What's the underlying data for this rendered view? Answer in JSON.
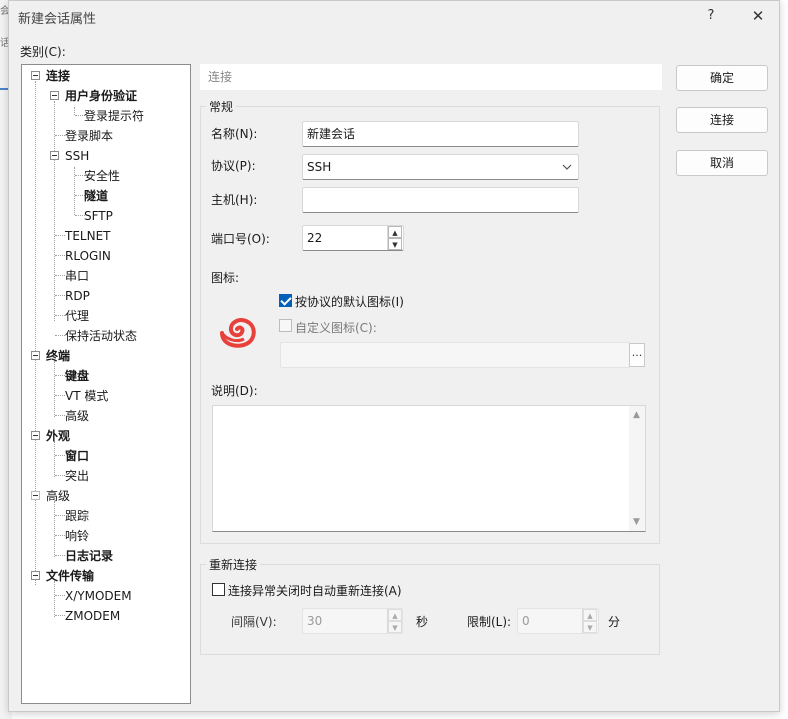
{
  "window": {
    "title": "新建会话属性",
    "help_glyph": "?",
    "close_glyph": "✕"
  },
  "background": {
    "marks": [
      "会",
      "话"
    ]
  },
  "category": {
    "label": "类别(C):",
    "tree": [
      {
        "label": "连接",
        "bold": true,
        "expanded": true
      },
      {
        "label": "用户身份验证",
        "bold": true,
        "expanded": true
      },
      {
        "label": "登录提示符",
        "bold": false
      },
      {
        "label": "登录脚本",
        "bold": false
      },
      {
        "label": "SSH",
        "bold": false,
        "expanded": true
      },
      {
        "label": "安全性",
        "bold": false
      },
      {
        "label": "隧道",
        "bold": true
      },
      {
        "label": "SFTP",
        "bold": false
      },
      {
        "label": "TELNET",
        "bold": false
      },
      {
        "label": "RLOGIN",
        "bold": false
      },
      {
        "label": "串口",
        "bold": false
      },
      {
        "label": "RDP",
        "bold": false
      },
      {
        "label": "代理",
        "bold": false
      },
      {
        "label": "保持活动状态",
        "bold": false
      },
      {
        "label": "终端",
        "bold": true,
        "expanded": true
      },
      {
        "label": "键盘",
        "bold": true
      },
      {
        "label": "VT 模式",
        "bold": false
      },
      {
        "label": "高级",
        "bold": false
      },
      {
        "label": "外观",
        "bold": true,
        "expanded": true
      },
      {
        "label": "窗口",
        "bold": true
      },
      {
        "label": "突出",
        "bold": false
      },
      {
        "label": "高级",
        "bold": false,
        "expanded": true
      },
      {
        "label": "跟踪",
        "bold": false
      },
      {
        "label": "响铃",
        "bold": false
      },
      {
        "label": "日志记录",
        "bold": true
      },
      {
        "label": "文件传输",
        "bold": true,
        "expanded": true
      },
      {
        "label": "X/YMODEM",
        "bold": false
      },
      {
        "label": "ZMODEM",
        "bold": false
      }
    ]
  },
  "section_title": "连接",
  "general": {
    "group_title": "常规",
    "name_label": "名称(N):",
    "name_value": "新建会话",
    "protocol_label": "协议(P):",
    "protocol_value": "SSH",
    "host_label": "主机(H):",
    "host_value": "",
    "port_label": "端口号(O):",
    "port_value": "22",
    "icon_label": "图标:",
    "default_icon_label": "按协议的默认图标(I)",
    "default_icon_checked": true,
    "custom_icon_label": "自定义图标(C):",
    "custom_icon_checked": false,
    "custom_icon_path": "",
    "browse_label": "...",
    "desc_label": "说明(D):",
    "desc_value": ""
  },
  "reconnect": {
    "group_title": "重新连接",
    "auto_label": "连接异常关闭时自动重新连接(A)",
    "auto_checked": false,
    "interval_label": "间隔(V):",
    "interval_value": "30",
    "interval_unit": "秒",
    "limit_label": "限制(L):",
    "limit_value": "0",
    "limit_unit": "分"
  },
  "buttons": {
    "ok": "确定",
    "connect": "连接",
    "cancel": "取消"
  },
  "colors": {
    "accent": "#005fb8",
    "icon": "#e8403a"
  },
  "icons": {
    "session_icon": "swirl-logo-icon",
    "select_arrow": "chevron-down-icon",
    "spin_up": "spin-up-icon",
    "spin_down": "spin-down-icon"
  }
}
